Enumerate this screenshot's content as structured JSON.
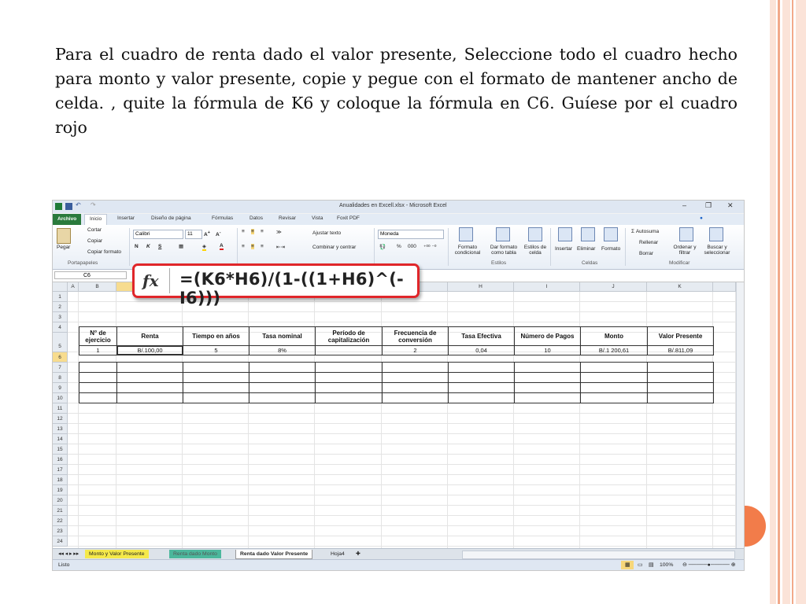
{
  "slide": {
    "text": "Para el cuadro de renta dado el valor presente, Seleccione todo el cuadro hecho para monto y valor presente, copie y pegue con el formato de mantener ancho de celda. , quite la fórmula de K6 y coloque la fórmula en C6. Guíese por el cuadro rojo",
    "colors": {
      "stripe_light": "#fbe3d8",
      "stripe_dark": "#f2a98a",
      "accent_circle": "#f27c4a"
    }
  },
  "excel": {
    "title": "Anualidades en Excell.xlsx - Microsoft Excel",
    "window_controls": [
      "–",
      "❐",
      "✕"
    ],
    "tabs": [
      "Archivo",
      "Inicio",
      "Insertar",
      "Diseño de página",
      "Fórmulas",
      "Datos",
      "Revisar",
      "Vista",
      "Foxit PDF"
    ],
    "ribbon": {
      "portapapeles": {
        "paste": "Pegar",
        "cut": "Cortar",
        "copy": "Copiar",
        "format_painter": "Copiar formato",
        "group": "Portapapeles"
      },
      "font": {
        "name": "Calibri",
        "size": "11",
        "bold": "N",
        "italic": "K",
        "underline": "S"
      },
      "alignment": {
        "wrap": "Ajustar texto",
        "merge": "Combinar y centrar"
      },
      "number": {
        "format": "Moneda",
        "percent": "%",
        "thousands": "000"
      },
      "estilos": {
        "conditional": "Formato condicional",
        "as_table": "Dar formato como tabla",
        "cell_styles": "Estilos de celda",
        "group": "Estilos"
      },
      "celdas": {
        "insert": "Insertar",
        "delete": "Eliminar",
        "format": "Formato",
        "group": "Celdas"
      },
      "modificar": {
        "autosum": "Autosuma",
        "fill": "Rellenar",
        "clear": "Borrar",
        "sort": "Ordenar y filtrar",
        "find": "Buscar y seleccionar",
        "group": "Modificar"
      }
    },
    "name_box": "C6",
    "formula_callout": {
      "fx": "fx",
      "formula": "=(K6*H6)/(1-((1+H6)^(-I6)))"
    },
    "columns": [
      "A",
      "B",
      "C",
      "D",
      "E",
      "F",
      "G",
      "H",
      "I",
      "J",
      "K"
    ],
    "rows": [
      "1",
      "2",
      "3",
      "4",
      "5",
      "6",
      "7",
      "8",
      "9",
      "10",
      "11",
      "12",
      "13",
      "14",
      "15",
      "16",
      "17",
      "18",
      "19",
      "20",
      "21",
      "22",
      "23",
      "24"
    ],
    "table": {
      "headers": [
        "N° de ejercicio",
        "Renta",
        "Tiempo en años",
        "Tasa nominal",
        "Período de capitalización",
        "Frecuencia de conversión",
        "Tasa Efectiva",
        "Número de Pagos",
        "Monto",
        "Valor Presente"
      ],
      "row6": [
        "1",
        "B/.100,00",
        "5",
        "8%",
        "",
        "2",
        "0,04",
        "10",
        "B/.1 200,61",
        "B/.811,09"
      ]
    },
    "sheet_tabs": [
      "Monto y Valor Presente",
      "Renta dado Monto",
      "Renta dado Valor Presente",
      "Hoja4"
    ],
    "status": {
      "ready": "Listo",
      "zoom": "100%"
    }
  }
}
